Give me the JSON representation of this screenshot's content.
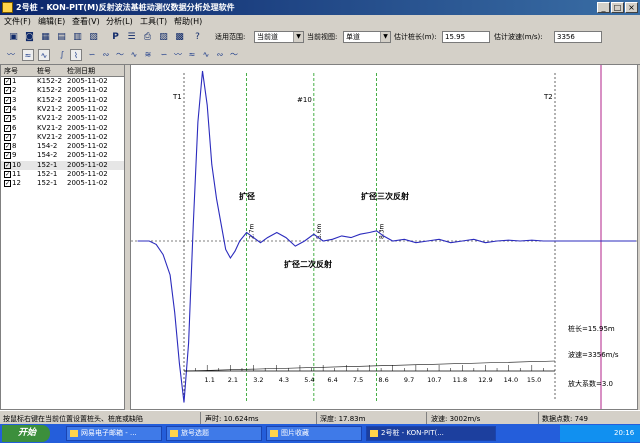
{
  "window": {
    "title": "2号桩 - KON-PIT(M)反射波法基桩动测仪数据分析处理软件"
  },
  "menu": [
    "文件(F)",
    "编辑(E)",
    "查看(V)",
    "分析(L)",
    "工具(T)",
    "帮助(H)"
  ],
  "toolbar": {
    "range_label": "适用范围:",
    "range_value": "当前道",
    "view_label": "当前视图:",
    "view_value": "单道",
    "pile_len_label": "估计桩长(m):",
    "pile_len_value": "15.95",
    "wave_speed_label": "估计波速(m/s):",
    "wave_speed_value": "3356"
  },
  "list": {
    "headers": [
      "序号",
      "桩号",
      "检测日期"
    ],
    "rows": [
      [
        "1",
        "K152-2",
        "2005-11-02"
      ],
      [
        "2",
        "K152-2",
        "2005-11-02"
      ],
      [
        "3",
        "K152-2",
        "2005-11-02"
      ],
      [
        "4",
        "KV21-2",
        "2005-11-02"
      ],
      [
        "5",
        "KV21-2",
        "2005-11-02"
      ],
      [
        "6",
        "KV21-2",
        "2005-11-02"
      ],
      [
        "7",
        "KV21-2",
        "2005-11-02"
      ],
      [
        "8",
        "154-2",
        "2005-11-02"
      ],
      [
        "9",
        "154-2",
        "2005-11-02"
      ],
      [
        "10",
        "152-1",
        "2005-11-02"
      ],
      [
        "11",
        "152-1",
        "2005-11-02"
      ],
      [
        "12",
        "152-1",
        "2005-11-02"
      ]
    ],
    "selected_index": 9
  },
  "plot": {
    "marker_t1": "T1",
    "marker_t2": "T2",
    "trace_label": "#10",
    "ann_kuojing": "扩径",
    "ann_kuojing3": "扩径三次反射",
    "ann_kuojing2": "扩径二次反射",
    "vlabel1": "2.7m",
    "vlabel2": "5.6m",
    "vlabel3": "8.3m",
    "info_length": "桩长=15.95m",
    "info_speed": "波速=3356m/s",
    "info_gain": "放大系数=3.0",
    "scale_ticks": [
      "1.1",
      "2.1",
      "3.2",
      "4.3",
      "5.4",
      "6.4",
      "7.5",
      "8.6",
      "9.7",
      "10.7",
      "11.8",
      "12.9",
      "14.0",
      "15.0"
    ]
  },
  "chart_data": {
    "type": "line",
    "x_unit": "m",
    "xlim": [
      0,
      16
    ],
    "x_ticks": [
      1.1,
      2.1,
      3.2,
      4.3,
      5.4,
      6.4,
      7.5,
      8.6,
      9.7,
      10.7,
      11.8,
      12.9,
      14.0,
      15.0
    ],
    "markers": [
      2.7,
      5.6,
      8.3
    ],
    "wave": {
      "x": [
        -2.0,
        -1.5,
        -1.2,
        -0.9,
        -0.6,
        -0.4,
        -0.2,
        0.0,
        0.2,
        0.4,
        0.6,
        0.8,
        1.0,
        1.2,
        1.4,
        1.6,
        1.8,
        2.0,
        2.2,
        2.4,
        2.7,
        3.0,
        3.3,
        3.6,
        4.0,
        4.4,
        4.8,
        5.2,
        5.6,
        6.0,
        6.4,
        6.8,
        7.2,
        7.6,
        8.0,
        8.3,
        8.6,
        9.0,
        9.5,
        10.0,
        10.5,
        11.0,
        11.5,
        12.0,
        12.5,
        13.0,
        13.5,
        14.0,
        14.5,
        15.0,
        15.5,
        16.0
      ],
      "y": [
        0,
        0,
        -0.02,
        -0.08,
        -0.2,
        -0.42,
        -0.72,
        -0.95,
        -0.6,
        0.1,
        0.7,
        1.0,
        0.8,
        0.45,
        0.25,
        0.1,
        -0.05,
        -0.1,
        -0.06,
        0.0,
        0.05,
        0.02,
        -0.01,
        0.02,
        0.05,
        0.02,
        -0.03,
        0.0,
        0.04,
        0.0,
        0.01,
        0.03,
        0.02,
        0.04,
        0.05,
        0.06,
        0.03,
        0.0,
        0.01,
        -0.01,
        0.0,
        0.01,
        -0.01,
        0.0,
        0.01,
        -0.01,
        0.0,
        0.005,
        0.0,
        0.005,
        0.0,
        0.0
      ]
    }
  },
  "statusbar": {
    "hint": "按鼠标右键在当前位置设置桩头、桩底或缺陷",
    "time": "声时: 10.624ms",
    "depth": "深度: 17.83m",
    "wavespeed": "波速: 3002m/s",
    "points": "数据点数: 749"
  },
  "taskbar": {
    "start": "开始",
    "tasks": [
      "网易电子邮箱 - ...",
      "旅号选题",
      "图片收藏",
      "2号桩 - KON-PIT(..."
    ],
    "clock": "20:16"
  },
  "colors": {
    "wave": "#2b2bbd",
    "dash_marker": "#1a9a1a",
    "cursor": "#b0208a"
  }
}
